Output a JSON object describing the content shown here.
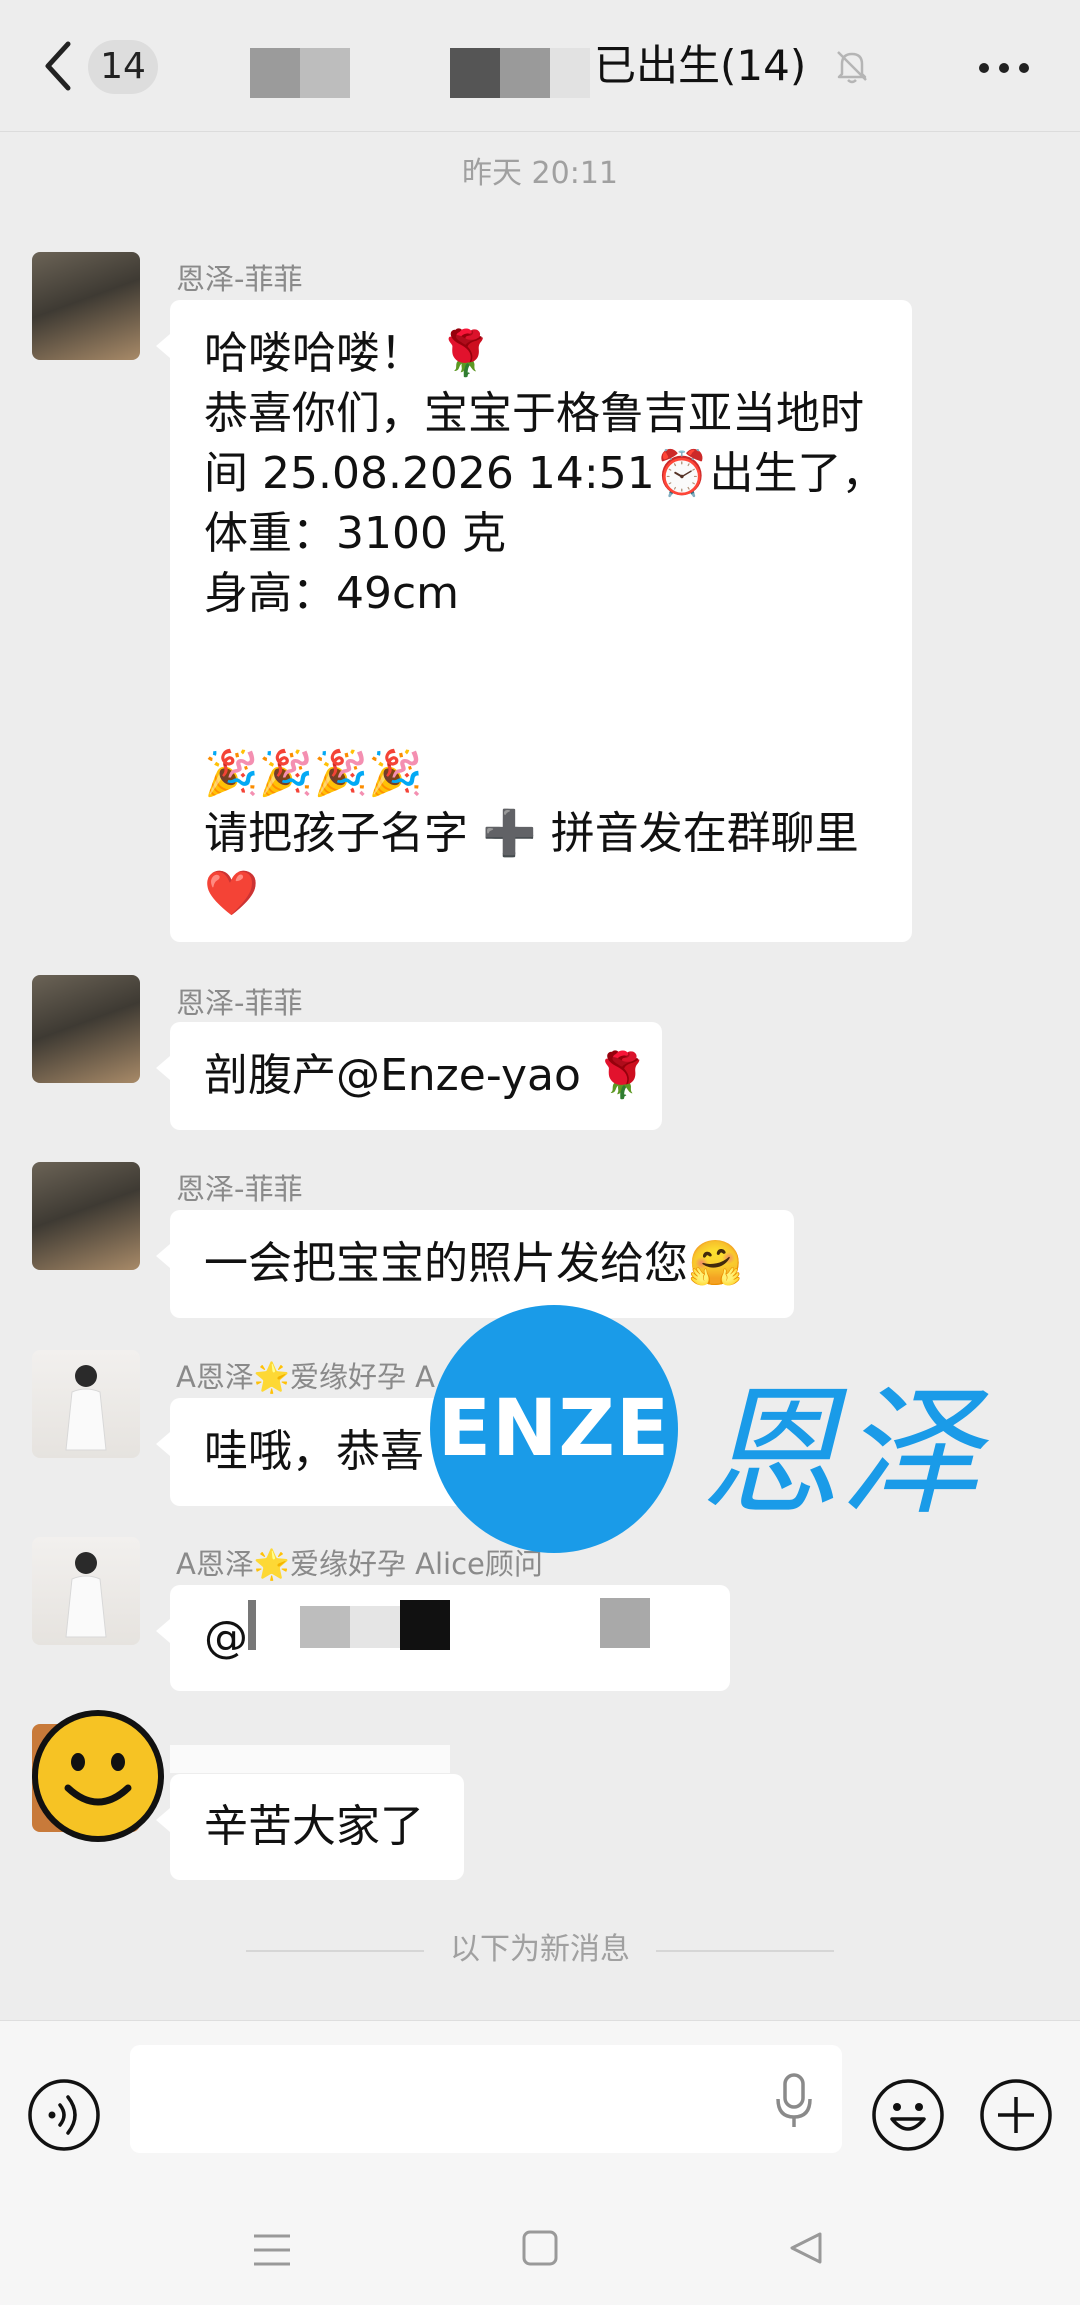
{
  "header": {
    "unread_count": "14",
    "title": "已出生(14)"
  },
  "timestamp": "昨天 20:11",
  "messages": [
    {
      "sender": "恩泽-菲菲",
      "lines": [
        "哈喽哈喽！ 🌹",
        "恭喜你们，宝宝于格鲁吉亚当地时",
        "间 25.08.2026 14:51⏰出生了，",
        "体重：3100 克",
        "身高：49cm",
        "",
        "",
        "🎉🎉🎉🎉",
        "请把孩子名字 ➕ 拼音发在群聊里",
        "❤️"
      ]
    },
    {
      "sender": "恩泽-菲菲",
      "text": "剖腹产@Enze-yao 🌹"
    },
    {
      "sender": "恩泽-菲菲",
      "text": "一会把宝宝的照片发给您🤗"
    },
    {
      "sender": "A恩泽🌟爱缘好孕 A",
      "text": "哇哦，恭喜"
    },
    {
      "sender": "A恩泽🌟爱缘好孕 Alice顾问",
      "text": "@"
    },
    {
      "sender": "",
      "text": "辛苦大家了"
    }
  ],
  "watermark": {
    "logo": "ENZE",
    "text": "恩泽"
  },
  "divider_label": "以下为新消息",
  "input": {
    "placeholder": ""
  },
  "colors": {
    "background": "#ededed",
    "bubble": "#ffffff",
    "brand": "#1a9be8"
  },
  "icons": [
    "back-arrow-icon",
    "mute-bell-icon",
    "more-icon",
    "voice-icon",
    "mic-icon",
    "emoji-icon",
    "plus-icon",
    "menu-icon",
    "home-icon",
    "nav-back-icon"
  ]
}
